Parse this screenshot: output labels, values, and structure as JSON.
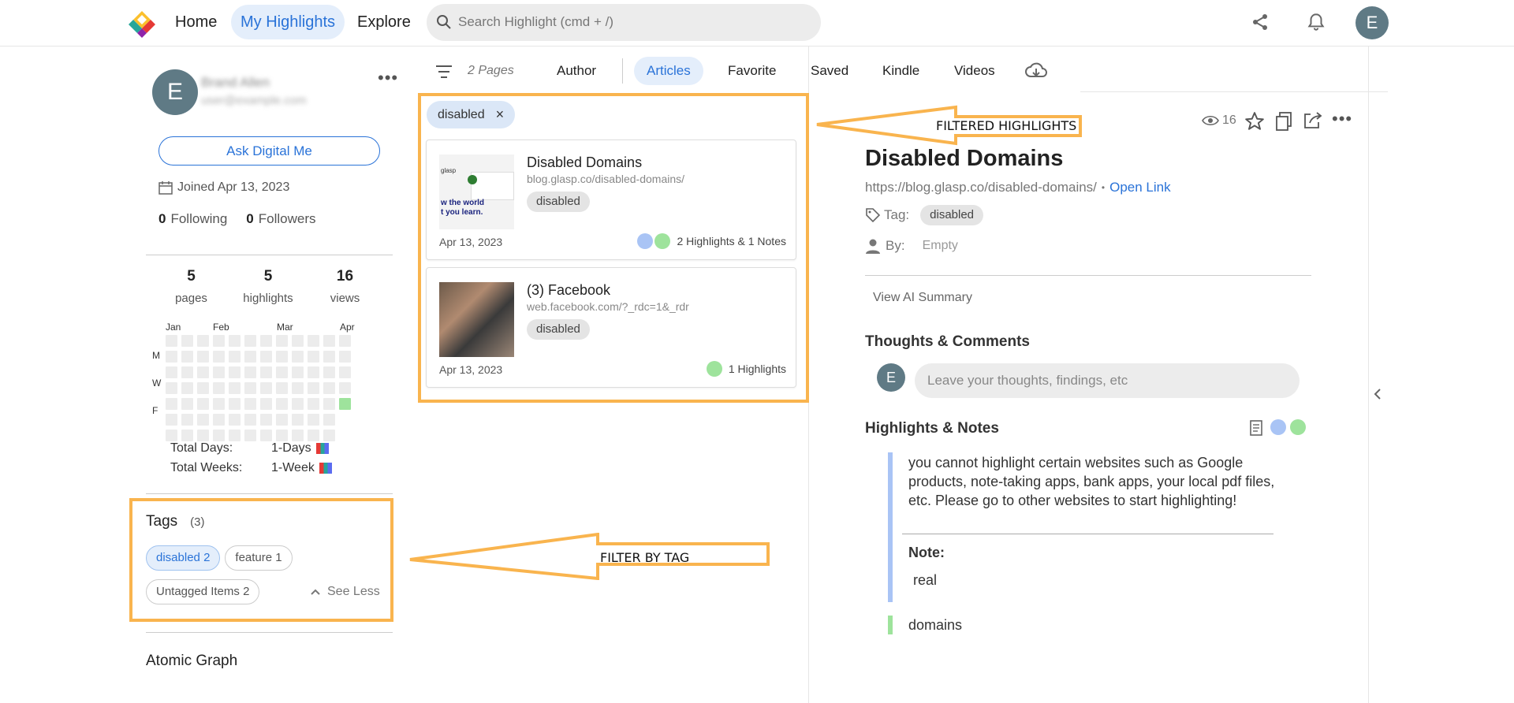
{
  "nav": {
    "home": "Home",
    "my_highlights": "My Highlights",
    "explore": "Explore",
    "search_placeholder": "Search Highlight (cmd + /)",
    "user_initial": "E"
  },
  "profile": {
    "initial": "E",
    "name": "Brand Allen",
    "email": "user@example.com",
    "ask_button": "Ask Digital Me",
    "joined": "Joined Apr 13, 2023",
    "following_count": "0",
    "following_label": "Following",
    "followers_count": "0",
    "followers_label": "Followers"
  },
  "stats": [
    {
      "value": "5",
      "label": "pages"
    },
    {
      "value": "5",
      "label": "highlights"
    },
    {
      "value": "16",
      "label": "views"
    }
  ],
  "calendar": {
    "months": [
      "Jan",
      "Feb",
      "Mar",
      "Apr"
    ],
    "days": [
      "M",
      "W",
      "F"
    ],
    "total_days_label": "Total Days:",
    "total_days_value": "1-Days",
    "total_weeks_label": "Total Weeks:",
    "total_weeks_value": "1-Week"
  },
  "tags": {
    "title": "Tags",
    "count": "(3)",
    "items": [
      {
        "name": "disabled",
        "count": "2"
      },
      {
        "name": "feature",
        "count": "1"
      },
      {
        "name": "Untagged Items",
        "count": "2"
      }
    ],
    "see_less": "See Less"
  },
  "atomic_graph": "Atomic Graph",
  "filters": {
    "pages_count": "2 Pages",
    "tabs": [
      "Author",
      "Articles",
      "Favorite",
      "Saved",
      "Kindle",
      "Videos"
    ],
    "active_tag": "disabled"
  },
  "cards": [
    {
      "title": "Disabled Domains",
      "url": "blog.glasp.co/disabled-domains/",
      "tag": "disabled",
      "date": "Apr 13, 2023",
      "summary": "2 Highlights & 1 Notes",
      "thumb_text": "w the world\nt you learn.",
      "thumb_brand": "glasp"
    },
    {
      "title": "(3) Facebook",
      "url": "web.facebook.com/?_rdc=1&_rdr",
      "tag": "disabled",
      "date": "Apr 13, 2023",
      "summary": "1 Highlights"
    }
  ],
  "detail": {
    "views": "16",
    "title": "Disabled Domains",
    "url": "https://blog.glasp.co/disabled-domains/",
    "separator": "•",
    "open_link": "Open Link",
    "tag_label": "Tag:",
    "tag": "disabled",
    "by_label": "By:",
    "by_value": "Empty",
    "ai_summary": "View AI Summary",
    "thoughts_title": "Thoughts & Comments",
    "comment_initial": "E",
    "comment_placeholder": "Leave your thoughts, findings, etc",
    "highlights_title": "Highlights & Notes",
    "highlight_1": "you cannot highlight certain websites such as Google products, note-taking apps, bank apps, your local pdf files, etc. Please go to other websites to start highlighting!",
    "note_label": "Note:",
    "note_text": "real",
    "highlight_2": "domains"
  },
  "annotations": {
    "filtered": "FILTERED HIGHLIGHTS",
    "filter_by_tag": "FILTER BY TAG"
  },
  "colors": {
    "accent": "#2a73d8",
    "highlight_blue": "#a9c4f5",
    "highlight_green": "#9ee39c",
    "annotation_orange": "#f9b44e"
  }
}
